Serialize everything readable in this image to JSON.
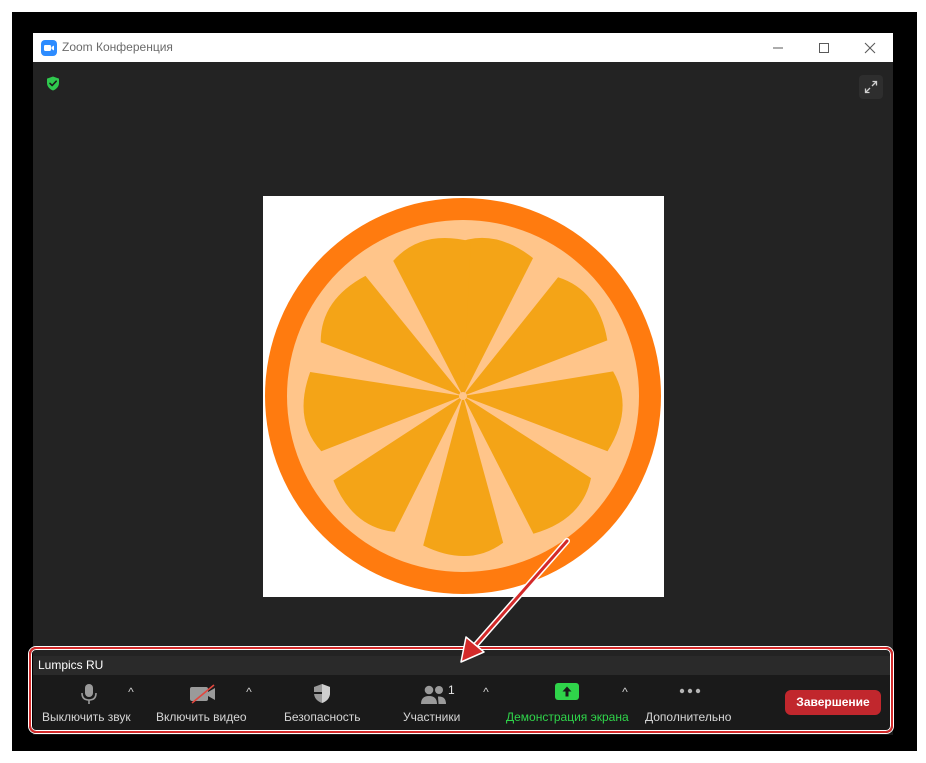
{
  "window": {
    "title": "Zoom Конференция"
  },
  "participant": {
    "name": "Lumpics RU"
  },
  "toolbar": {
    "mute_label": "Выключить звук",
    "video_label": "Включить видео",
    "security_label": "Безопасность",
    "participants_label": "Участники",
    "participants_count": "1",
    "share_label": "Демонстрация экрана",
    "more_label": "Дополнительно",
    "end_label": "Завершение",
    "caret_glyph": "^"
  },
  "colors": {
    "background": "#232323",
    "toolbar_background": "#1a1a1a",
    "share_accent": "#2fd44a",
    "end_button": "#c1272d",
    "security_green": "#2fc94e",
    "annotation_red": "#d32a2a",
    "orange_rim": "#ff7b0f",
    "orange_pith": "#ffc58a",
    "orange_segment": "#f4a417"
  },
  "icons": {
    "app": "zoom-camera-icon",
    "security": "shield-check-icon",
    "fullscreen": "expand-icon",
    "mute": "microphone-icon",
    "video": "video-camera-off-icon",
    "security_button": "shield-icon",
    "participants": "people-icon",
    "share": "share-screen-up-arrow-icon",
    "more": "ellipsis-icon"
  }
}
